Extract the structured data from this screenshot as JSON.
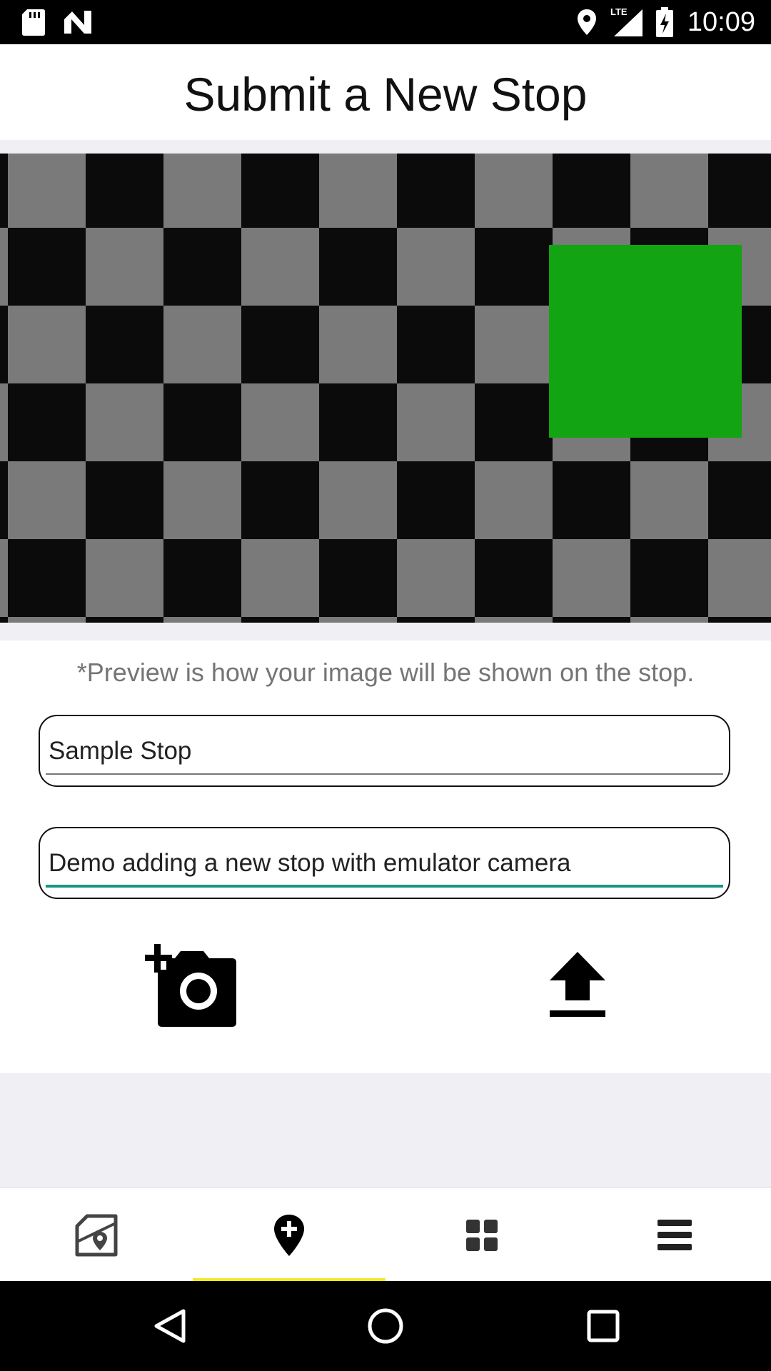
{
  "status_bar": {
    "time": "10:09",
    "network_label": "LTE",
    "icons": [
      "sd-card-icon",
      "n-notification-icon",
      "location-icon",
      "signal-icon",
      "battery-charging-icon"
    ]
  },
  "header": {
    "title": "Submit a New Stop"
  },
  "preview": {
    "colors": {
      "dark_square": "#0b0b0b",
      "light_square": "#7a7a7a",
      "green_square": "#12a412"
    }
  },
  "form": {
    "preview_note": "*Preview is how your image will be shown on the stop.",
    "stop_name": {
      "value": "Sample Stop"
    },
    "stop_description": {
      "value": "Demo adding a new stop with emulator camera"
    }
  },
  "actions": {
    "icons": [
      "add-photo-icon",
      "upload-icon"
    ]
  },
  "bottom_nav": {
    "items": [
      {
        "icon": "map-icon",
        "selected": false
      },
      {
        "icon": "add-location-icon",
        "selected": true
      },
      {
        "icon": "grid-icon",
        "selected": false
      },
      {
        "icon": "menu-icon",
        "selected": false
      }
    ],
    "indicator_color": "#f3e82c"
  },
  "system_nav": {
    "icons": [
      "back-icon",
      "home-icon",
      "recents-icon"
    ]
  },
  "colors": {
    "accent": "#17938a",
    "background": "#efeff4"
  }
}
